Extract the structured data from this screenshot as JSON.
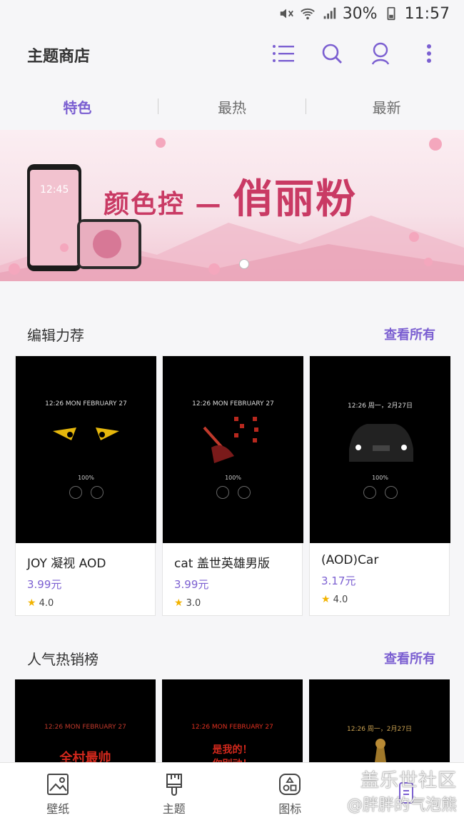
{
  "status_bar": {
    "battery": "30%",
    "time": "11:57"
  },
  "app_bar": {
    "title": "主题商店",
    "icons": [
      "list-icon",
      "search-icon",
      "account-icon",
      "more-icon"
    ]
  },
  "tabs": [
    {
      "label": "特色",
      "active": true
    },
    {
      "label": "最热",
      "active": false
    },
    {
      "label": "最新",
      "active": false
    }
  ],
  "banner": {
    "text_small": "颜色控 —",
    "text_big": "俏丽粉",
    "phone_clock": "12:45"
  },
  "section_featured": {
    "title": "编辑力荐",
    "more": "查看所有",
    "items": [
      {
        "name": "JOY 凝视 AOD",
        "price": "3.99元",
        "rating": "4.0",
        "thumb_clock": "12:26  MON FEBRUARY 27",
        "battery": "100%"
      },
      {
        "name": "cat 盖世英雄男版",
        "price": "3.99元",
        "rating": "3.0",
        "thumb_clock": "12:26  MON FEBRUARY 27",
        "battery": "100%"
      },
      {
        "name": "(AOD)Car",
        "price": "3.17元",
        "rating": "4.0",
        "thumb_clock": "12:26  周一，2月27日",
        "battery": "100%"
      }
    ]
  },
  "section_popular": {
    "title": "人气热销榜",
    "more": "查看所有",
    "items": [
      {
        "thumb_clock": "12:26  MON FEBRUARY 27",
        "text": "全村最帅"
      },
      {
        "thumb_clock": "12:26  MON FEBRUARY 27",
        "text": "是我的！\n你别动！"
      },
      {
        "thumb_clock": "12:26  周一，2月27日",
        "text": ""
      }
    ]
  },
  "bottom_nav": [
    {
      "label": "壁纸",
      "icon": "wallpaper-icon"
    },
    {
      "label": "主题",
      "icon": "theme-brush-icon"
    },
    {
      "label": "图标",
      "icon": "icons-icon"
    },
    {
      "label": "",
      "icon": "aod-icon"
    }
  ],
  "watermark": {
    "line1": "盖乐世社区",
    "line2": "@胖胖的气泡熊"
  },
  "colors": {
    "accent": "#7b5fd1",
    "background": "#f6f6f8",
    "card_bg": "#ffffff",
    "star": "#f2b300"
  }
}
